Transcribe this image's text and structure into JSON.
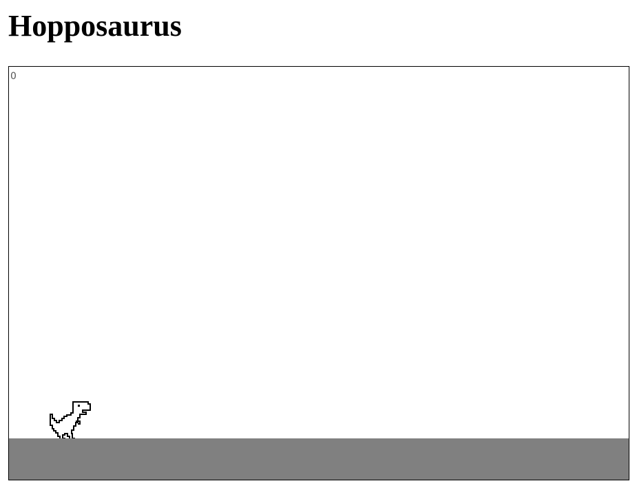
{
  "page": {
    "title": "Hopposaurus"
  },
  "game": {
    "score": "0",
    "player_icon": "t-rex-dinosaur-icon",
    "colors": {
      "background": "#ffffff",
      "ground": "#808080",
      "border": "#000000",
      "score_text": "#555555",
      "dino_outline": "#000000"
    }
  }
}
